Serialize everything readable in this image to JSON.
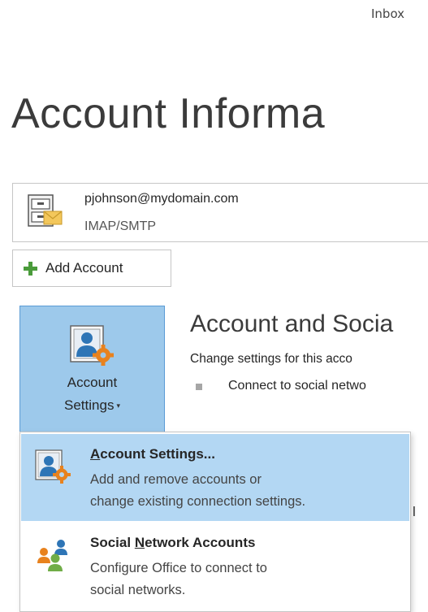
{
  "header": {
    "folder_label": "Inbox"
  },
  "page": {
    "title": "Account Informa"
  },
  "account": {
    "email": "pjohnson@mydomain.com",
    "type": "IMAP/SMTP",
    "icon": "mail-account-icon"
  },
  "add_account": {
    "label": "Add Account",
    "icon": "plus-icon",
    "icon_color": "#4a9b3b"
  },
  "account_settings_button": {
    "line1": "Account",
    "line2": "Settings",
    "caret": "▾",
    "icon": "account-settings-icon",
    "bg_color": "#9dc9eb"
  },
  "section": {
    "title": "Account and Socia",
    "description": "Change settings for this acco",
    "bullet": "Connect to social netwo"
  },
  "right_clip": {
    "text": "l"
  },
  "dropdown": {
    "items": [
      {
        "title_pre": "",
        "title_mnemonic": "A",
        "title_post": "ccount Settings...",
        "desc1": "Add and remove accounts or",
        "desc2": "change existing connection settings.",
        "icon": "account-settings-icon",
        "highlighted": true
      },
      {
        "title_pre": "Social ",
        "title_mnemonic": "N",
        "title_post": "etwork Accounts",
        "desc1": "Configure Office to connect to",
        "desc2": "social networks.",
        "icon": "social-network-people-icon",
        "highlighted": false
      }
    ]
  },
  "colors": {
    "highlight": "#b3d7f3",
    "gear_orange": "#e8821e",
    "person_blue": "#2e75b6",
    "green_person": "#70ad47"
  }
}
